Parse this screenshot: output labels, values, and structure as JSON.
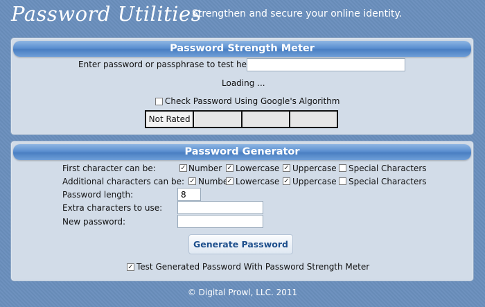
{
  "header": {
    "title": "Password Utilities",
    "tagline": "Strengthen and secure your online identity."
  },
  "strength_meter": {
    "title": "Password Strength Meter",
    "prompt_label": "Enter password or passphrase to test here:",
    "password_value": "",
    "loading_text": "Loading ...",
    "google_check_label": "Check Password Using Google's Algorithm",
    "google_check_checked": false,
    "rating_cells": [
      "Not Rated",
      "",
      "",
      ""
    ]
  },
  "generator": {
    "title": "Password Generator",
    "first_char_label": "First character can be:",
    "additional_chars_label": "Additional characters can be:",
    "options": {
      "number": "Number",
      "lowercase": "Lowercase",
      "uppercase": "Uppercase",
      "special": "Special Characters"
    },
    "first_char_checks": {
      "number": true,
      "lowercase": true,
      "uppercase": true,
      "special": false
    },
    "additional_char_checks": {
      "number": true,
      "lowercase": true,
      "uppercase": true,
      "special": false
    },
    "length_label": "Password length:",
    "length_value": "8",
    "extra_chars_label": "Extra characters to use:",
    "extra_chars_value": "",
    "new_password_label": "New password:",
    "new_password_value": "",
    "generate_button": "Generate Password",
    "test_label": "Test Generated Password With Password Strength Meter",
    "test_checked": true
  },
  "footer": {
    "copyright": "© Digital Prowl, LLC. 2011"
  }
}
